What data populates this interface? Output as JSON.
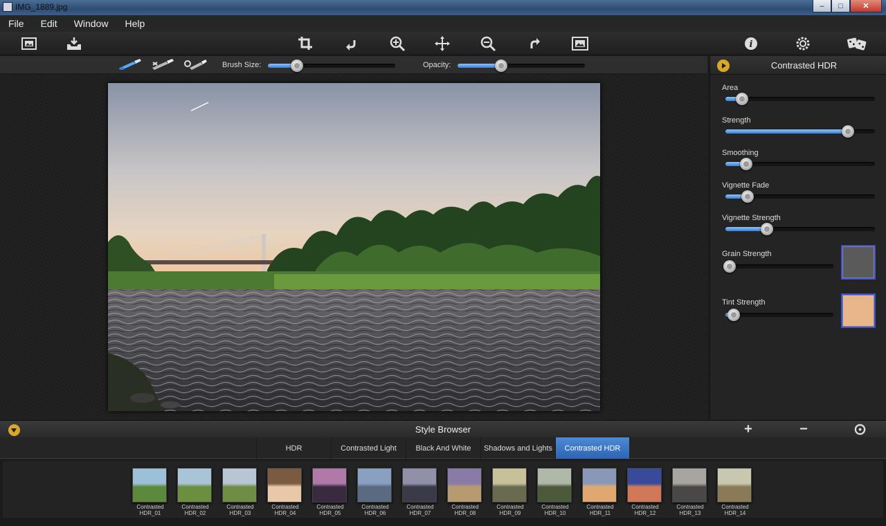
{
  "window": {
    "title": "IMG_1889.jpg",
    "minimize": "–",
    "maximize": "□",
    "close": "✕"
  },
  "menu": [
    "File",
    "Edit",
    "Window",
    "Help"
  ],
  "toolbar": {
    "left": [
      "open-image-icon",
      "save-icon"
    ],
    "center": [
      "crop-icon",
      "rotate-left-icon",
      "zoom-in-icon",
      "pan-icon",
      "zoom-out-icon",
      "rotate-right-icon",
      "fit-image-icon"
    ],
    "right": [
      "info-icon",
      "settings-icon",
      "random-dice-icon"
    ]
  },
  "brushbar": {
    "brushes": [
      "brush-paint-icon",
      "brush-erase-icon",
      "brush-reset-icon"
    ],
    "brush_size_label": "Brush Size:",
    "brush_size": 0.23,
    "opacity_label": "Opacity:",
    "opacity": 0.34
  },
  "panel": {
    "title": "Contrasted HDR",
    "controls": [
      {
        "label": "Area",
        "value": 0.11
      },
      {
        "label": "Strength",
        "value": 0.82
      },
      {
        "label": "Smoothing",
        "value": 0.14
      },
      {
        "label": "Vignette Fade",
        "value": 0.15
      },
      {
        "label": "Vignette Strength",
        "value": 0.28
      }
    ],
    "color_controls": [
      {
        "label": "Grain Strength",
        "value": 0.0,
        "swatch": "#5a5a5a"
      },
      {
        "label": "Tint Strength",
        "value": 0.04,
        "swatch": "#e8b68a"
      }
    ]
  },
  "style_browser": {
    "title": "Style Browser",
    "add": "+",
    "remove": "−",
    "tabs": [
      "HDR",
      "Contrasted Light",
      "Black And White",
      "Shadows and Lights",
      "Contrasted HDR"
    ],
    "active_tab": 4,
    "thumbs": [
      {
        "l1": "Contrasted",
        "l2": "HDR_01"
      },
      {
        "l1": "Contrasted",
        "l2": "HDR_02"
      },
      {
        "l1": "Contrasted",
        "l2": "HDR_03"
      },
      {
        "l1": "Contrasted",
        "l2": "HDR_04"
      },
      {
        "l1": "Contrasted",
        "l2": "HDR_05"
      },
      {
        "l1": "Contrasted",
        "l2": "HDR_06"
      },
      {
        "l1": "Contrasted",
        "l2": "HDR_07"
      },
      {
        "l1": "Contrasted",
        "l2": "HDR_08"
      },
      {
        "l1": "Contrasted",
        "l2": "HDR_09"
      },
      {
        "l1": "Contrasted",
        "l2": "HDR_10"
      },
      {
        "l1": "Contrasted",
        "l2": "HDR_11"
      },
      {
        "l1": "Contrasted",
        "l2": "HDR_12"
      },
      {
        "l1": "Contrasted",
        "l2": "HDR_13"
      },
      {
        "l1": "Contrasted",
        "l2": "HDR_14"
      }
    ]
  },
  "colors": {
    "accent": "#3b7fd0",
    "tab_active": "#3d74c4",
    "gold": "#d6a928"
  }
}
